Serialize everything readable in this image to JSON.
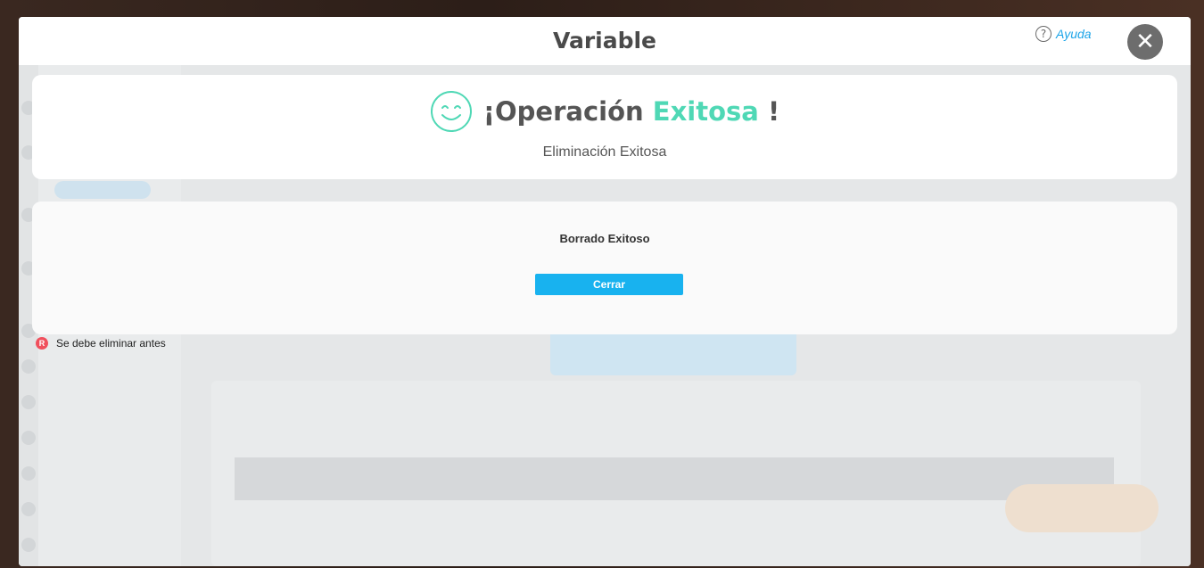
{
  "modal": {
    "title": "Variable",
    "help_label": "Ayuda",
    "help_glyph": "?",
    "close_glyph": "✕"
  },
  "success": {
    "heading_prefix": "¡Operación ",
    "heading_accent": "Exitosa",
    "heading_suffix": " !",
    "subtitle": "Eliminación Exitosa",
    "accent_color": "#4fd8b5",
    "icon": "smiley-icon"
  },
  "dialog": {
    "message": "Borrado Exitoso",
    "button_label": "Cerrar",
    "button_color": "#18b2ef"
  },
  "warning": {
    "badge": "R",
    "text": "Se debe eliminar antes",
    "badge_color": "#f0505d"
  }
}
